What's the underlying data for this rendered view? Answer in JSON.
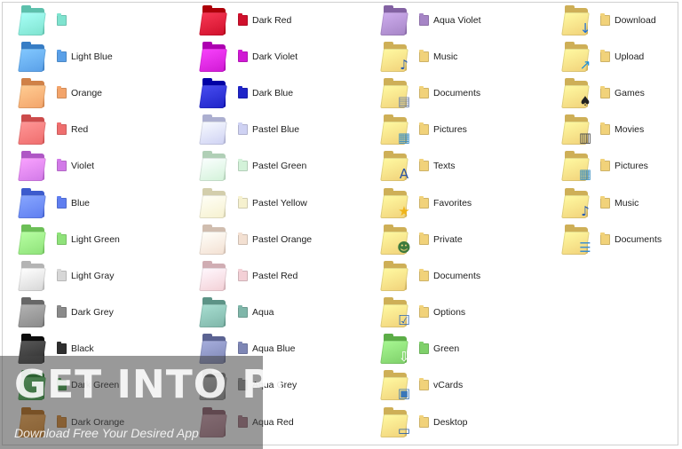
{
  "columns": [
    [
      {
        "label": "",
        "color": "#7fe3cf",
        "icon": "folder-icon"
      },
      {
        "label": "Light Blue",
        "color": "#5aa0e8",
        "icon": "folder-icon"
      },
      {
        "label": "Orange",
        "color": "#f3a46a",
        "icon": "folder-icon"
      },
      {
        "label": "Red",
        "color": "#ef6e6e",
        "icon": "folder-icon"
      },
      {
        "label": "Violet",
        "color": "#d27ae8",
        "icon": "folder-icon"
      },
      {
        "label": "Blue",
        "color": "#5f7ef0",
        "icon": "folder-icon"
      },
      {
        "label": "Light Green",
        "color": "#8fe27a",
        "icon": "folder-icon"
      },
      {
        "label": "Light Gray",
        "color": "#d7d7d7",
        "icon": "folder-icon"
      },
      {
        "label": "Dark Grey",
        "color": "#8a8a8a",
        "icon": "folder-icon"
      },
      {
        "label": "Black",
        "color": "#2f2f2f",
        "icon": "folder-icon"
      },
      {
        "label": "Dark Green",
        "color": "#2fa33a",
        "icon": "folder-icon"
      },
      {
        "label": "Dark Orange",
        "color": "#d9821f",
        "icon": "folder-icon"
      }
    ],
    [
      {
        "label": "Dark Red",
        "color": "#d0102c",
        "icon": "folder-icon"
      },
      {
        "label": "Dark Violet",
        "color": "#d01ad4",
        "icon": "folder-icon"
      },
      {
        "label": "Dark Blue",
        "color": "#1f24c8",
        "icon": "folder-icon"
      },
      {
        "label": "Pastel Blue",
        "color": "#cfd2f3",
        "icon": "folder-icon"
      },
      {
        "label": "Pastel Green",
        "color": "#d3f2d9",
        "icon": "folder-icon"
      },
      {
        "label": "Pastel Yellow",
        "color": "#f6f1cf",
        "icon": "folder-icon"
      },
      {
        "label": "Pastel Orange",
        "color": "#f3e0d2",
        "icon": "folder-icon"
      },
      {
        "label": "Pastel Red",
        "color": "#f3d0d6",
        "icon": "folder-icon"
      },
      {
        "label": "Aqua",
        "color": "#7fb6a9",
        "icon": "folder-icon"
      },
      {
        "label": "Aqua Blue",
        "color": "#7e86b5",
        "icon": "folder-icon"
      },
      {
        "label": "Aqua Grey",
        "color": "#8f8f8f",
        "icon": "folder-icon"
      },
      {
        "label": "Aqua Red",
        "color": "#a4707f",
        "icon": "folder-icon"
      }
    ],
    [
      {
        "label": "Aqua Violet",
        "color": "#a685c6",
        "icon": "folder-icon"
      },
      {
        "label": "Music",
        "color": "#f1d27a",
        "icon": "music-note-icon"
      },
      {
        "label": "Documents",
        "color": "#f1d27a",
        "icon": "document-icon"
      },
      {
        "label": "Pictures",
        "color": "#f1d27a",
        "icon": "picture-icon"
      },
      {
        "label": "Texts",
        "color": "#f1d27a",
        "icon": "letter-a-icon"
      },
      {
        "label": "Favorites",
        "color": "#f1d27a",
        "icon": "star-icon"
      },
      {
        "label": "Private",
        "color": "#f1d27a",
        "icon": "user-icon"
      },
      {
        "label": "Documents",
        "color": "#f1d27a",
        "icon": "folder-icon"
      },
      {
        "label": "Options",
        "color": "#f1d27a",
        "icon": "checklist-icon"
      },
      {
        "label": "Green",
        "color": "#7fd06a",
        "icon": "arrow-down-icon"
      },
      {
        "label": "vCards",
        "color": "#f1d27a",
        "icon": "contact-card-icon"
      },
      {
        "label": "Desktop",
        "color": "#f1d27a",
        "icon": "monitor-icon"
      }
    ],
    [
      {
        "label": "Download",
        "color": "#f1d27a",
        "icon": "download-arrow-icon"
      },
      {
        "label": "Upload",
        "color": "#f1d27a",
        "icon": "upload-arrow-icon"
      },
      {
        "label": "Games",
        "color": "#f1d27a",
        "icon": "spade-icon"
      },
      {
        "label": "Movies",
        "color": "#f1d27a",
        "icon": "film-icon"
      },
      {
        "label": "Pictures",
        "color": "#f1d27a",
        "icon": "picture-icon"
      },
      {
        "label": "Music",
        "color": "#f1d27a",
        "icon": "music-note-icon"
      },
      {
        "label": "Documents",
        "color": "#f1d27a",
        "icon": "library-icon"
      }
    ]
  ],
  "watermark": {
    "title": "GET INTO PC",
    "subtitle": "Download Free Your Desired App"
  }
}
